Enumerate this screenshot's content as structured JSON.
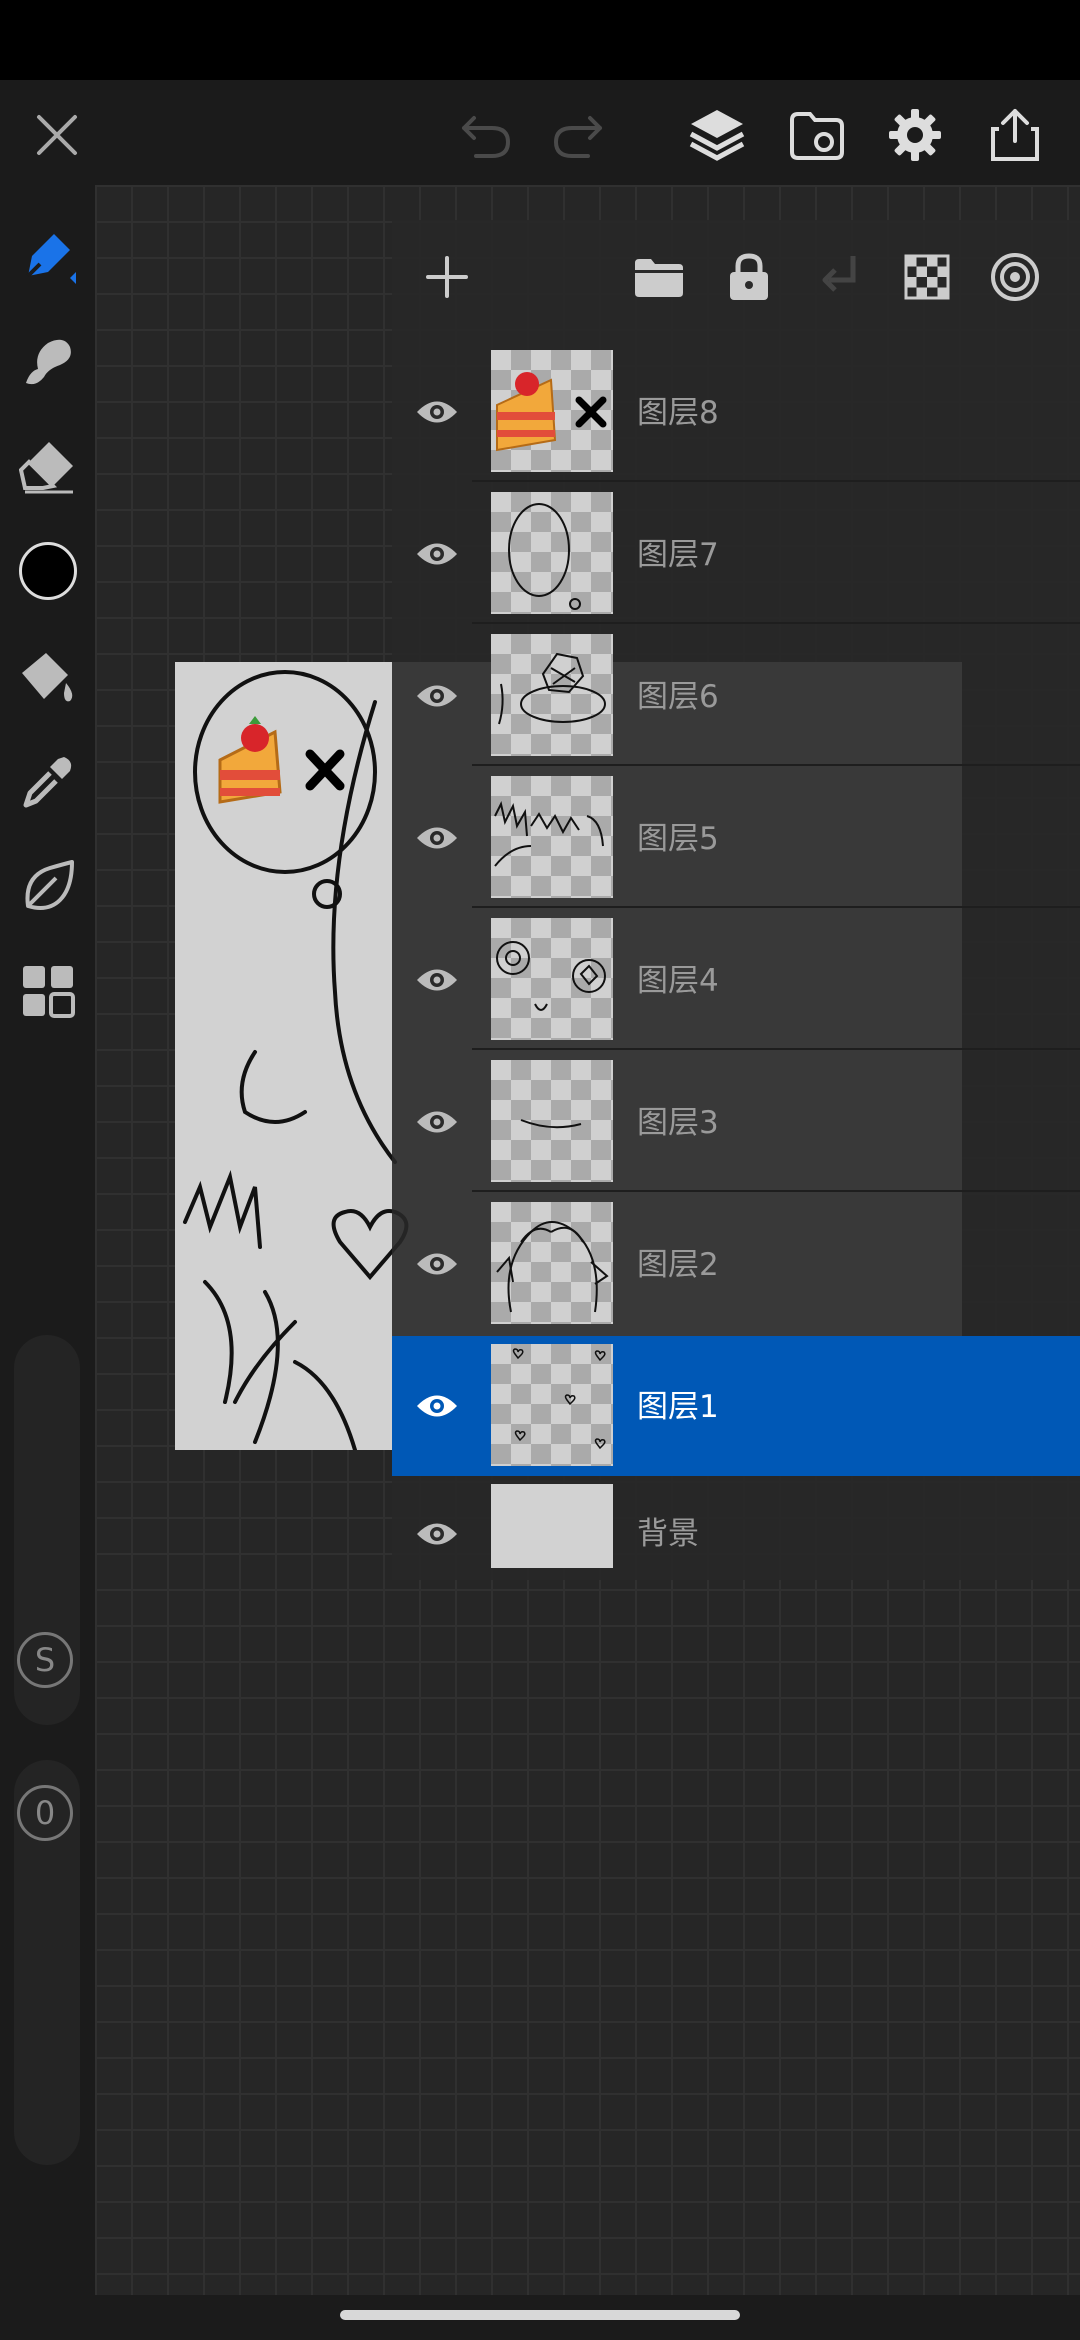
{
  "topbar": {
    "icons": [
      "close-icon",
      "undo-icon",
      "redo-icon",
      "layers-icon",
      "reference-icon",
      "settings-icon",
      "share-icon"
    ]
  },
  "left_toolbar": {
    "tools": [
      "pen-tool-icon",
      "smudge-tool-icon",
      "eraser-tool-icon",
      "color-swatch",
      "fill-tool-icon",
      "eyedropper-tool-icon",
      "shape-tool-icon",
      "grid-tool-icon"
    ],
    "current_color": "#000000",
    "size_label": "S",
    "opacity_label": "0"
  },
  "layers_panel": {
    "toolbar_icons": [
      "add-icon",
      "folder-icon",
      "lock-icon",
      "merge-down-icon",
      "transparency-icon",
      "clipping-icon"
    ],
    "layers": [
      {
        "name": "图层8",
        "selected": false
      },
      {
        "name": "图层7",
        "selected": false
      },
      {
        "name": "图层6",
        "selected": false
      },
      {
        "name": "图层5",
        "selected": false
      },
      {
        "name": "图层4",
        "selected": false
      },
      {
        "name": "图层3",
        "selected": false
      },
      {
        "name": "图层2",
        "selected": false
      },
      {
        "name": "图层1",
        "selected": true
      },
      {
        "name": "背景",
        "selected": false
      }
    ]
  },
  "colors": {
    "accent": "#0058b6",
    "pen_active": "#1a73e8"
  }
}
